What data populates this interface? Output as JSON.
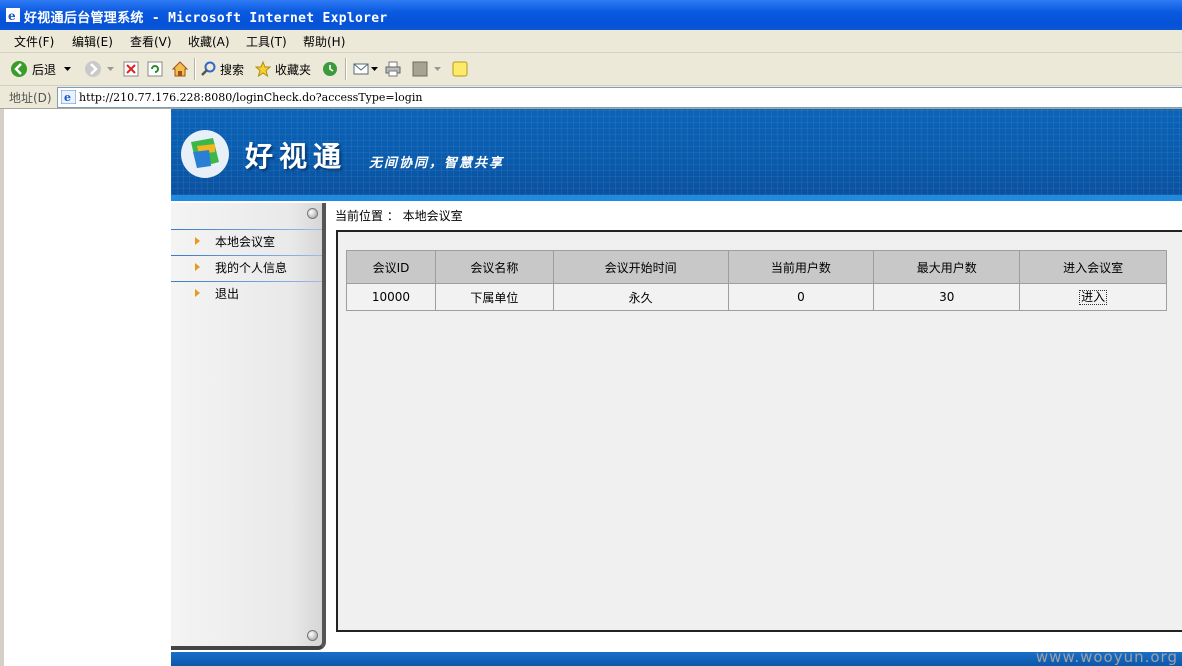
{
  "window": {
    "title": "好视通后台管理系统 - Microsoft Internet Explorer"
  },
  "menu": {
    "file": "文件(F)",
    "edit": "编辑(E)",
    "view": "查看(V)",
    "favorites": "收藏(A)",
    "tools": "工具(T)",
    "help": "帮助(H)"
  },
  "toolbar": {
    "back": "后退",
    "search": "搜索",
    "favorites": "收藏夹"
  },
  "address": {
    "label": "地址(D)",
    "url": "http://210.77.176.228:8080/loginCheck.do?accessType=login"
  },
  "banner": {
    "brand": "好视通",
    "slogan": "无间协同，智慧共享"
  },
  "sidebar": {
    "items": [
      {
        "label": "本地会议室"
      },
      {
        "label": "我的个人信息"
      },
      {
        "label": "退出"
      }
    ]
  },
  "main": {
    "breadcrumb": "当前位置 ： 本地会议室",
    "table": {
      "headers": [
        "会议ID",
        "会议名称",
        "会议开始时间",
        "当前用户数",
        "最大用户数",
        "进入会议室"
      ],
      "rows": [
        {
          "id": "10000",
          "name": "下属单位",
          "start": "永久",
          "current": "0",
          "max": "30",
          "action": "进入"
        }
      ]
    }
  },
  "watermark": "www.wooyun.org"
}
